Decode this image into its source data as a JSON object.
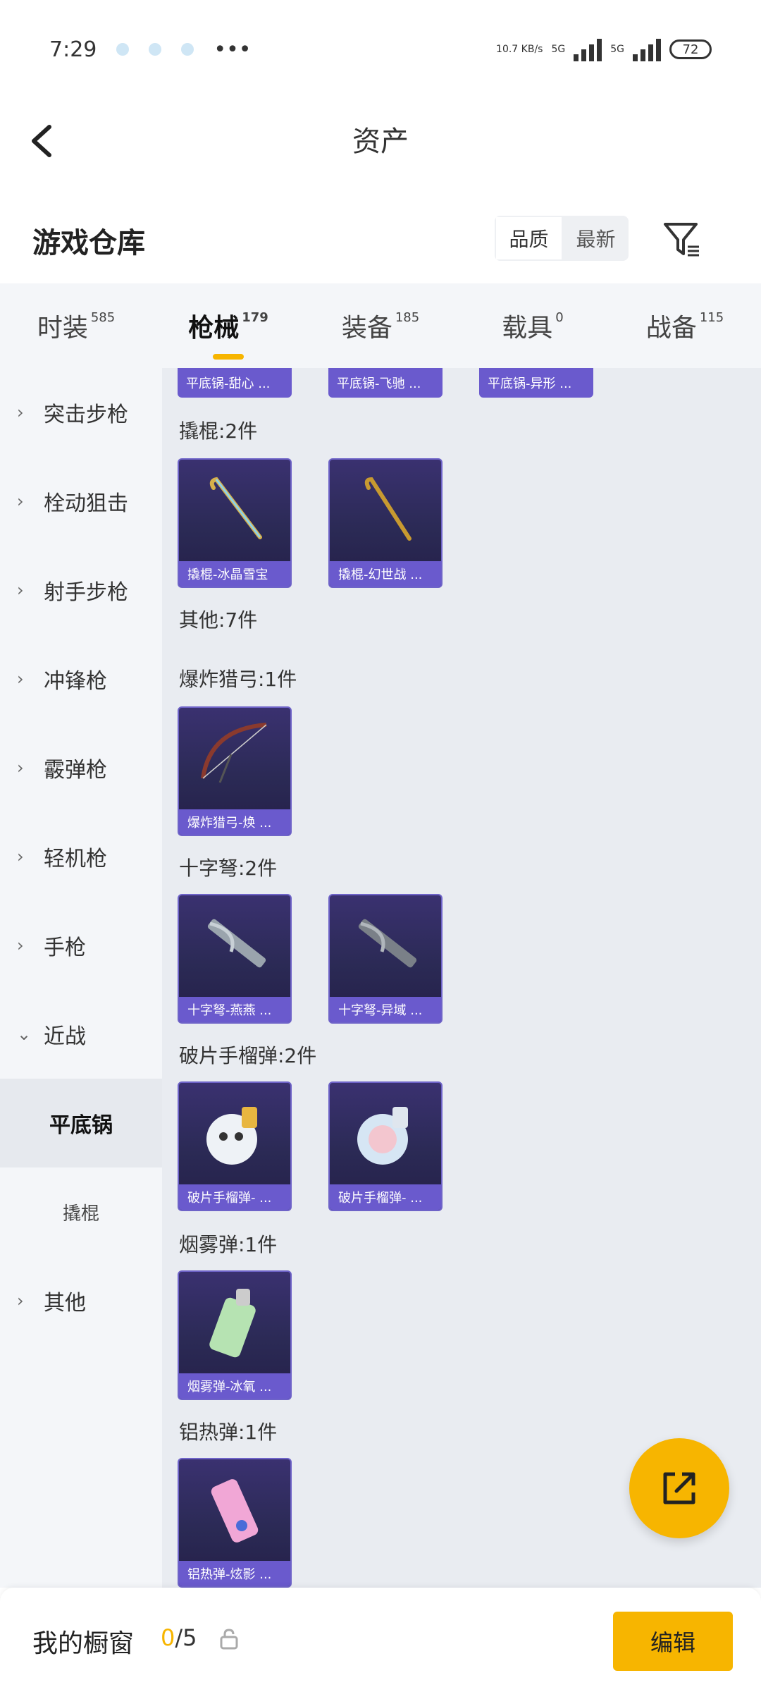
{
  "status_bar": {
    "time": "7:29",
    "net_speed": "10.7 KB/s",
    "network1": "5G",
    "network2": "5G",
    "battery": "72"
  },
  "header": {
    "title": "资产"
  },
  "warehouse": {
    "title": "游戏仓库",
    "sort_options": [
      "品质",
      "最新"
    ],
    "active_sort": "品质"
  },
  "tabs": [
    {
      "label": "时装",
      "count": "585"
    },
    {
      "label": "枪械",
      "count": "179"
    },
    {
      "label": "装备",
      "count": "185"
    },
    {
      "label": "载具",
      "count": "0"
    },
    {
      "label": "战备",
      "count": "115"
    }
  ],
  "sidebar": {
    "items": [
      {
        "label": "突击步枪"
      },
      {
        "label": "栓动狙击"
      },
      {
        "label": "射手步枪"
      },
      {
        "label": "冲锋枪"
      },
      {
        "label": "霰弹枪"
      },
      {
        "label": "轻机枪"
      },
      {
        "label": "手枪"
      },
      {
        "label": "近战"
      },
      {
        "label": "平底锅"
      },
      {
        "label": "撬棍"
      },
      {
        "label": "其他"
      }
    ]
  },
  "content": {
    "partial_items": [
      "平底锅-甜心 ...",
      "平底锅-飞驰 ...",
      "平底锅-异形 ..."
    ],
    "sections": [
      {
        "label": "撬棍:2件",
        "items": [
          "撬棍-冰晶雪宝",
          "撬棍-幻世战 ..."
        ]
      },
      {
        "label": "其他:7件",
        "items": []
      },
      {
        "label": "爆炸猎弓:1件",
        "items": [
          "爆炸猎弓-焕 ..."
        ]
      },
      {
        "label": "十字弩:2件",
        "items": [
          "十字弩-燕燕 ...",
          "十字弩-异域 ..."
        ]
      },
      {
        "label": "破片手榴弹:2件",
        "items": [
          "破片手榴弹- ...",
          "破片手榴弹- ..."
        ]
      },
      {
        "label": "烟雾弹:1件",
        "items": [
          "烟雾弹-冰氧 ..."
        ]
      },
      {
        "label": "铝热弹:1件",
        "items": [
          "铝热弹-炫影 ..."
        ]
      }
    ]
  },
  "bottom_bar": {
    "label": "我的橱窗",
    "current": "0",
    "total": "/5",
    "edit_label": "编辑"
  }
}
